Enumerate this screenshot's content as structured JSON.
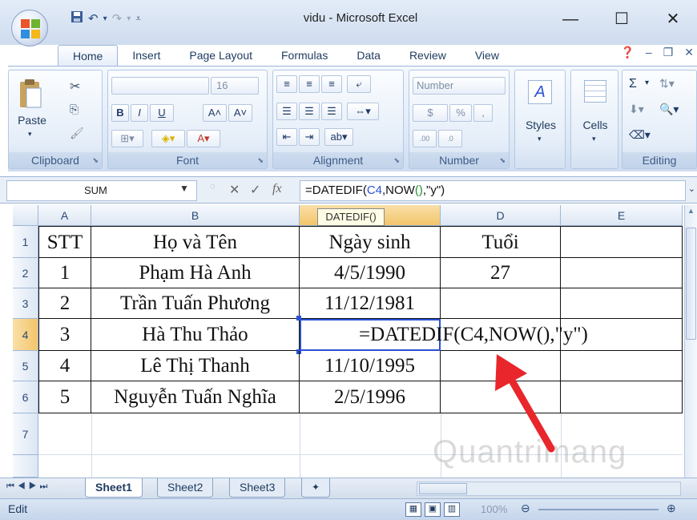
{
  "window": {
    "title": "vidu - Microsoft Excel",
    "minimize_glyph": "—",
    "maximize_glyph": "☐",
    "close_glyph": "✕"
  },
  "quick_access": {
    "save_icon": "save-icon",
    "undo_glyph": "↶",
    "redo_glyph": "↷",
    "customize_glyph": "⩡"
  },
  "ribbon": {
    "tabs": [
      "Home",
      "Insert",
      "Page Layout",
      "Formulas",
      "Data",
      "Review",
      "View"
    ],
    "active_tab": "Home",
    "groups": {
      "clipboard": {
        "label": "Clipboard",
        "paste_label": "Paste"
      },
      "font": {
        "label": "Font",
        "font_size": "16",
        "bold": "B",
        "italic": "I",
        "underline": "U"
      },
      "alignment": {
        "label": "Alignment"
      },
      "number": {
        "label": "Number",
        "format": "Number",
        "currency": "$",
        "percent": "%",
        "comma": ",",
        "inc_dec": "←.0 .00",
        "dec_dec": ".00 →.0"
      },
      "styles": {
        "label": "Styles"
      },
      "cells": {
        "label": "Cells"
      },
      "editing": {
        "label": "Editing",
        "sum_glyph": "Σ"
      }
    }
  },
  "formula_bar": {
    "name_box": "SUM",
    "cancel_glyph": "✕",
    "enter_glyph": "✓",
    "fx_glyph": "fx",
    "formula": {
      "part1": "=DATEDIF(",
      "ref": "C4",
      "part2": ",NOW",
      "paren": "()",
      "part3": ",\"y\")"
    }
  },
  "tooltip": "DATEDIF()",
  "sheet": {
    "columns": [
      "A",
      "B",
      "C",
      "D",
      "E"
    ],
    "rows": [
      {
        "num": "1",
        "cells": [
          "STT",
          "Họ và Tên",
          "Ngày sinh",
          "Tuổi",
          ""
        ]
      },
      {
        "num": "2",
        "cells": [
          "1",
          "Phạm Hà Anh",
          "4/5/1990",
          "27",
          ""
        ]
      },
      {
        "num": "3",
        "cells": [
          "2",
          "Trần Tuấn Phương",
          "11/12/1981",
          "",
          ""
        ]
      },
      {
        "num": "4",
        "cells": [
          "3",
          "Hà Thu Thảo",
          "=DATEDIF(C4,NOW(),\"y\")",
          "",
          ""
        ]
      },
      {
        "num": "5",
        "cells": [
          "4",
          "Lê Thị Thanh",
          "11/10/1995",
          "",
          ""
        ]
      },
      {
        "num": "6",
        "cells": [
          "5",
          "Nguyễn Tuấn Nghĩa",
          "2/5/1996",
          "",
          ""
        ]
      },
      {
        "num": "7",
        "cells": [
          "",
          "",
          "",
          "",
          ""
        ]
      }
    ],
    "selected_column": "C",
    "selected_row": "4"
  },
  "sheet_tabs": [
    "Sheet1",
    "Sheet2",
    "Sheet3"
  ],
  "active_sheet": "Sheet1",
  "status": {
    "mode": "Edit",
    "zoom": "100%"
  },
  "watermark": "Quantrimang",
  "colors": {
    "ribbon_blue": "#cfdcee",
    "selection_orange": "#f3c56a",
    "arrow_red": "#e8262b",
    "formula_ref_blue": "#2a51d6"
  }
}
